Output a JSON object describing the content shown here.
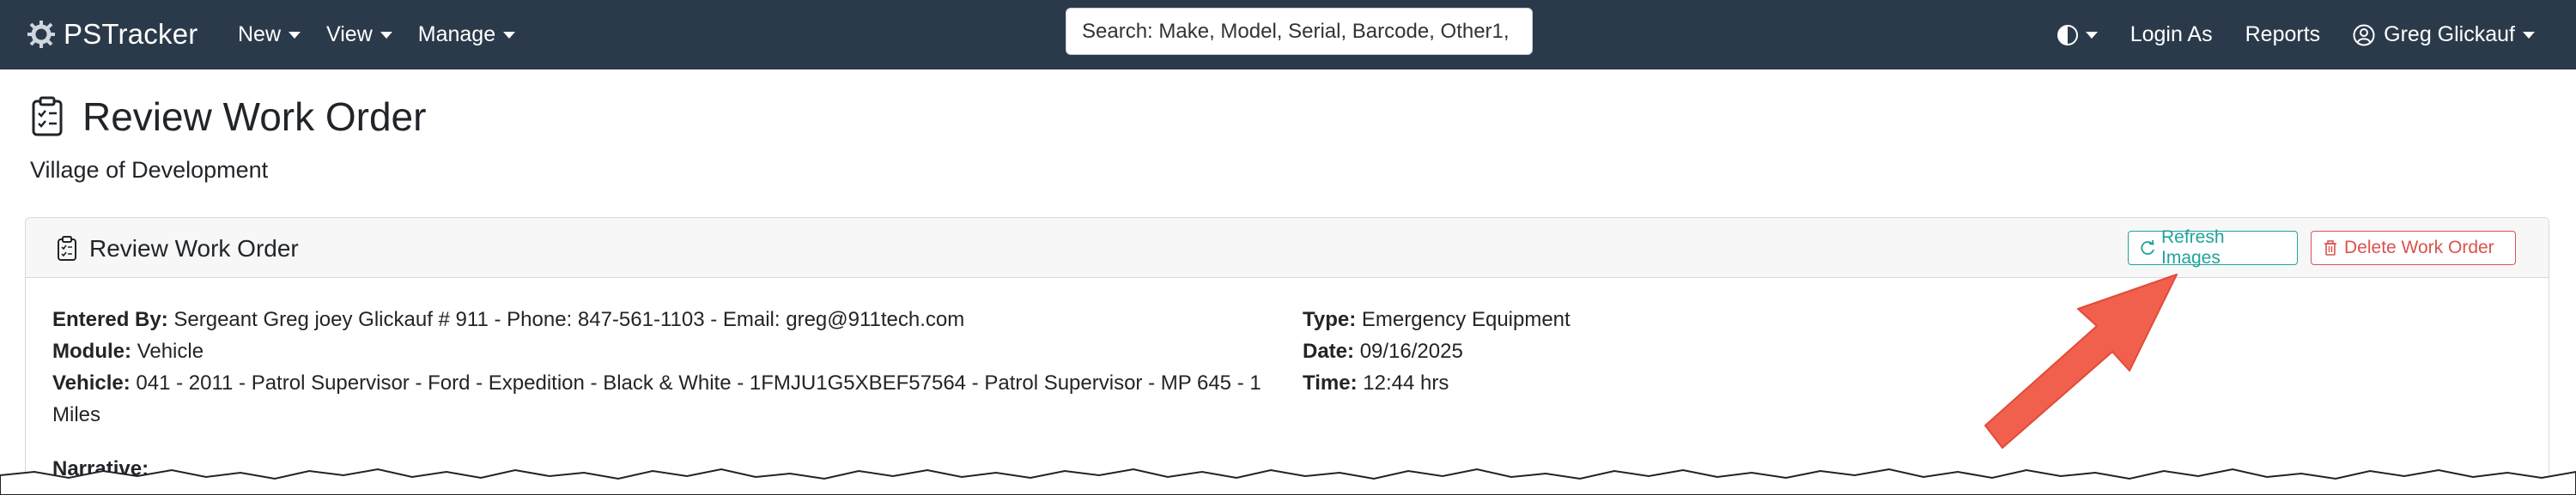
{
  "navbar": {
    "brand": "PSTracker",
    "menu": [
      {
        "label": "New"
      },
      {
        "label": "View"
      },
      {
        "label": "Manage"
      }
    ],
    "search_placeholder": "Search: Make, Model, Serial, Barcode, Other1,",
    "right": {
      "login_as": "Login As",
      "reports": "Reports",
      "user": "Greg Glickauf"
    }
  },
  "page": {
    "title": "Review Work Order",
    "subtitle": "Village of Development"
  },
  "card": {
    "title": "Review Work Order",
    "refresh_label": "Refresh Images",
    "delete_label": "Delete Work Order",
    "left": {
      "entered_by_label": "Entered By:",
      "entered_by": "Sergeant Greg joey Glickauf # 911 - Phone: 847-561-1103 - Email: greg@911tech.com",
      "module_label": "Module:",
      "module": "Vehicle",
      "vehicle_label": "Vehicle:",
      "vehicle": "041 - 2011 - Patrol Supervisor - Ford - Expedition - Black & White - 1FMJU1G5XBEF57564 - Patrol Supervisor - MP 645 - 1 Miles"
    },
    "right": {
      "type_label": "Type:",
      "type": "Emergency Equipment",
      "date_label": "Date:",
      "date": "09/16/2025",
      "time_label": "Time:",
      "time": "12:44 hrs"
    },
    "narrative_label": "Narrative:"
  },
  "colors": {
    "navbar": "#2b3a4a",
    "refresh": "#20a39a",
    "delete": "#d9534f",
    "arrow": "#f0604d"
  }
}
